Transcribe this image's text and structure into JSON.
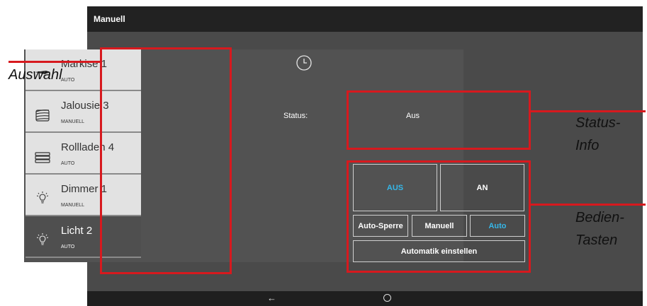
{
  "titlebar": {
    "title": "Manuell"
  },
  "devices": [
    {
      "name": "Markise 1",
      "mode": "AUTO",
      "icon": "awning-icon"
    },
    {
      "name": "Jalousie 3",
      "mode": "MANUELL",
      "icon": "blinds-icon"
    },
    {
      "name": "Rollladen 4",
      "mode": "AUTO",
      "icon": "shutter-icon"
    },
    {
      "name": "Dimmer 1",
      "mode": "MANUELL",
      "icon": "bulb-icon"
    },
    {
      "name": "Licht 2",
      "mode": "AUTO",
      "icon": "bulb-icon",
      "selected": true
    }
  ],
  "status": {
    "label": "Status:",
    "value": "Aus"
  },
  "buttons": {
    "aus": "AUS",
    "an": "AN",
    "auto_sperre": "Auto-Sperre",
    "manuell": "Manuell",
    "auto": "Auto",
    "automatik": "Automatik einstellen"
  },
  "nav": {
    "back": "←"
  },
  "annotations": {
    "auswahl": "Auswahl",
    "status_line1": "Status-",
    "status_line2": "Info",
    "bedien_line1": "Bedien-",
    "bedien_line2": "Tasten"
  },
  "colors": {
    "accent": "#35b7e9",
    "annotation_red": "#d7191e",
    "list_bg": "#e2e2e2",
    "screen_bg": "#4a4a4a"
  }
}
